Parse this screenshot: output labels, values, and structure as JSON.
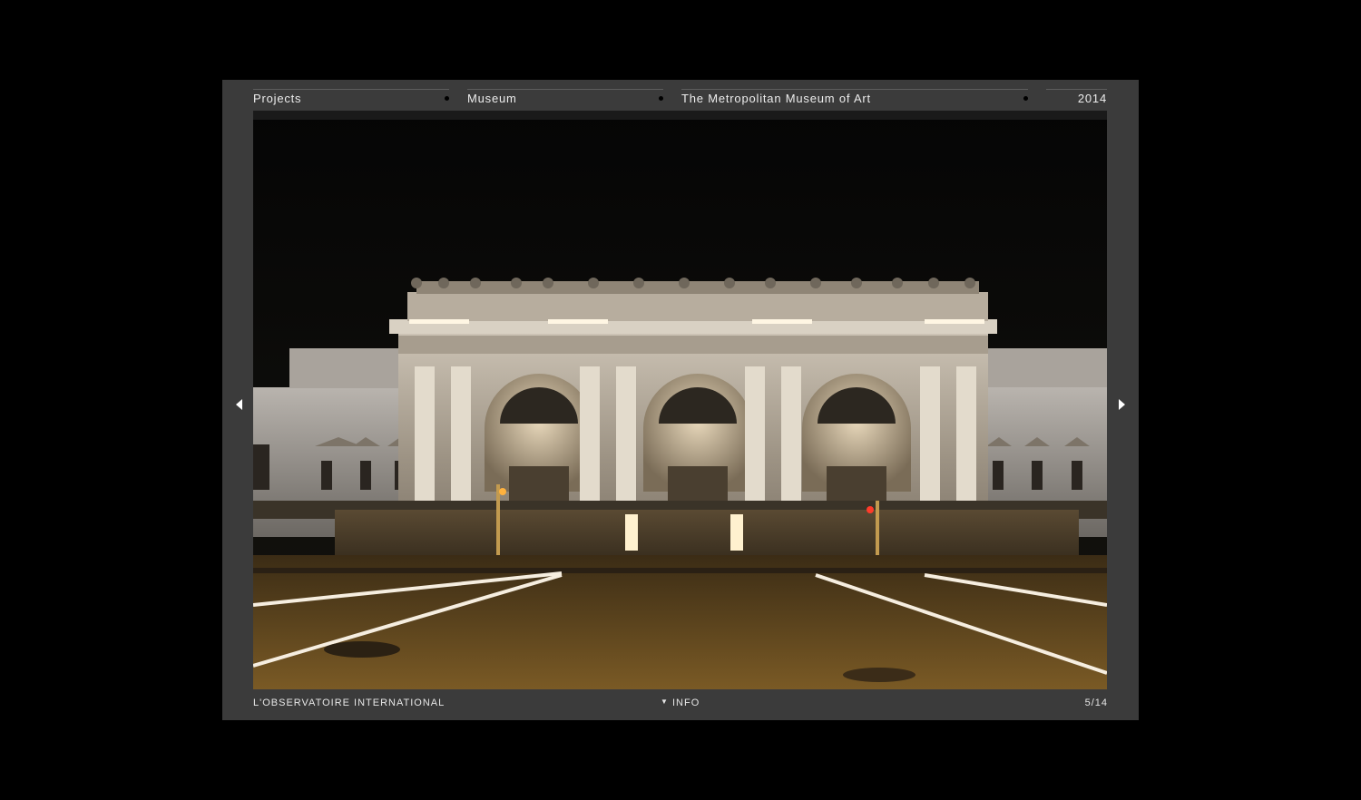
{
  "topnav": {
    "items": [
      {
        "label": "Projects"
      },
      {
        "label": "Museum"
      },
      {
        "label": "The Metropolitan Museum of Art"
      }
    ],
    "year": "2014"
  },
  "footer": {
    "brand": "L'OBSERVATOIRE INTERNATIONAL",
    "info_label": "INFO",
    "counter": "5/14"
  },
  "icons": {
    "prev": "triangle-left-icon",
    "next": "triangle-right-icon",
    "info": "caret-down-icon"
  },
  "colors": {
    "background": "#000000",
    "panel": "#3b3b3b",
    "text": "#e6e6e6"
  }
}
